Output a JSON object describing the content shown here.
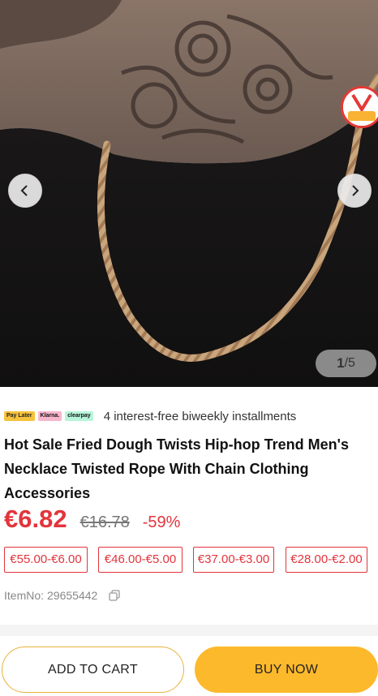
{
  "carousel": {
    "image_alt": "Gold twisted rope chain necklace worn on tattooed neck",
    "current": "1",
    "total": "/5",
    "badge_text": "Voghom",
    "prev_icon": "chevron-left-icon",
    "next_icon": "chevron-right-icon"
  },
  "payment": {
    "chips": [
      "Pay Later",
      "Klarna.",
      "clearpay"
    ],
    "text": "4 interest-free biweekly installments"
  },
  "product": {
    "title": "Hot Sale Fried Dough Twists Hip-hop Trend Men's Necklace Twisted Rope With Chain Clothing Accessories",
    "price": "€6.82",
    "original_price": "€16.78",
    "discount": "-59%",
    "tiers": [
      "€55.00-€6.00",
      "€46.00-€5.00",
      "€37.00-€3.00",
      "€28.00-€2.00"
    ],
    "item_label": "ItemNo:",
    "item_no": "29655442"
  },
  "actions": {
    "add_to_cart": "ADD TO CART",
    "buy_now": "BUY NOW"
  },
  "colors": {
    "accent_red": "#e3343b",
    "button_yellow": "#fdb92c"
  }
}
